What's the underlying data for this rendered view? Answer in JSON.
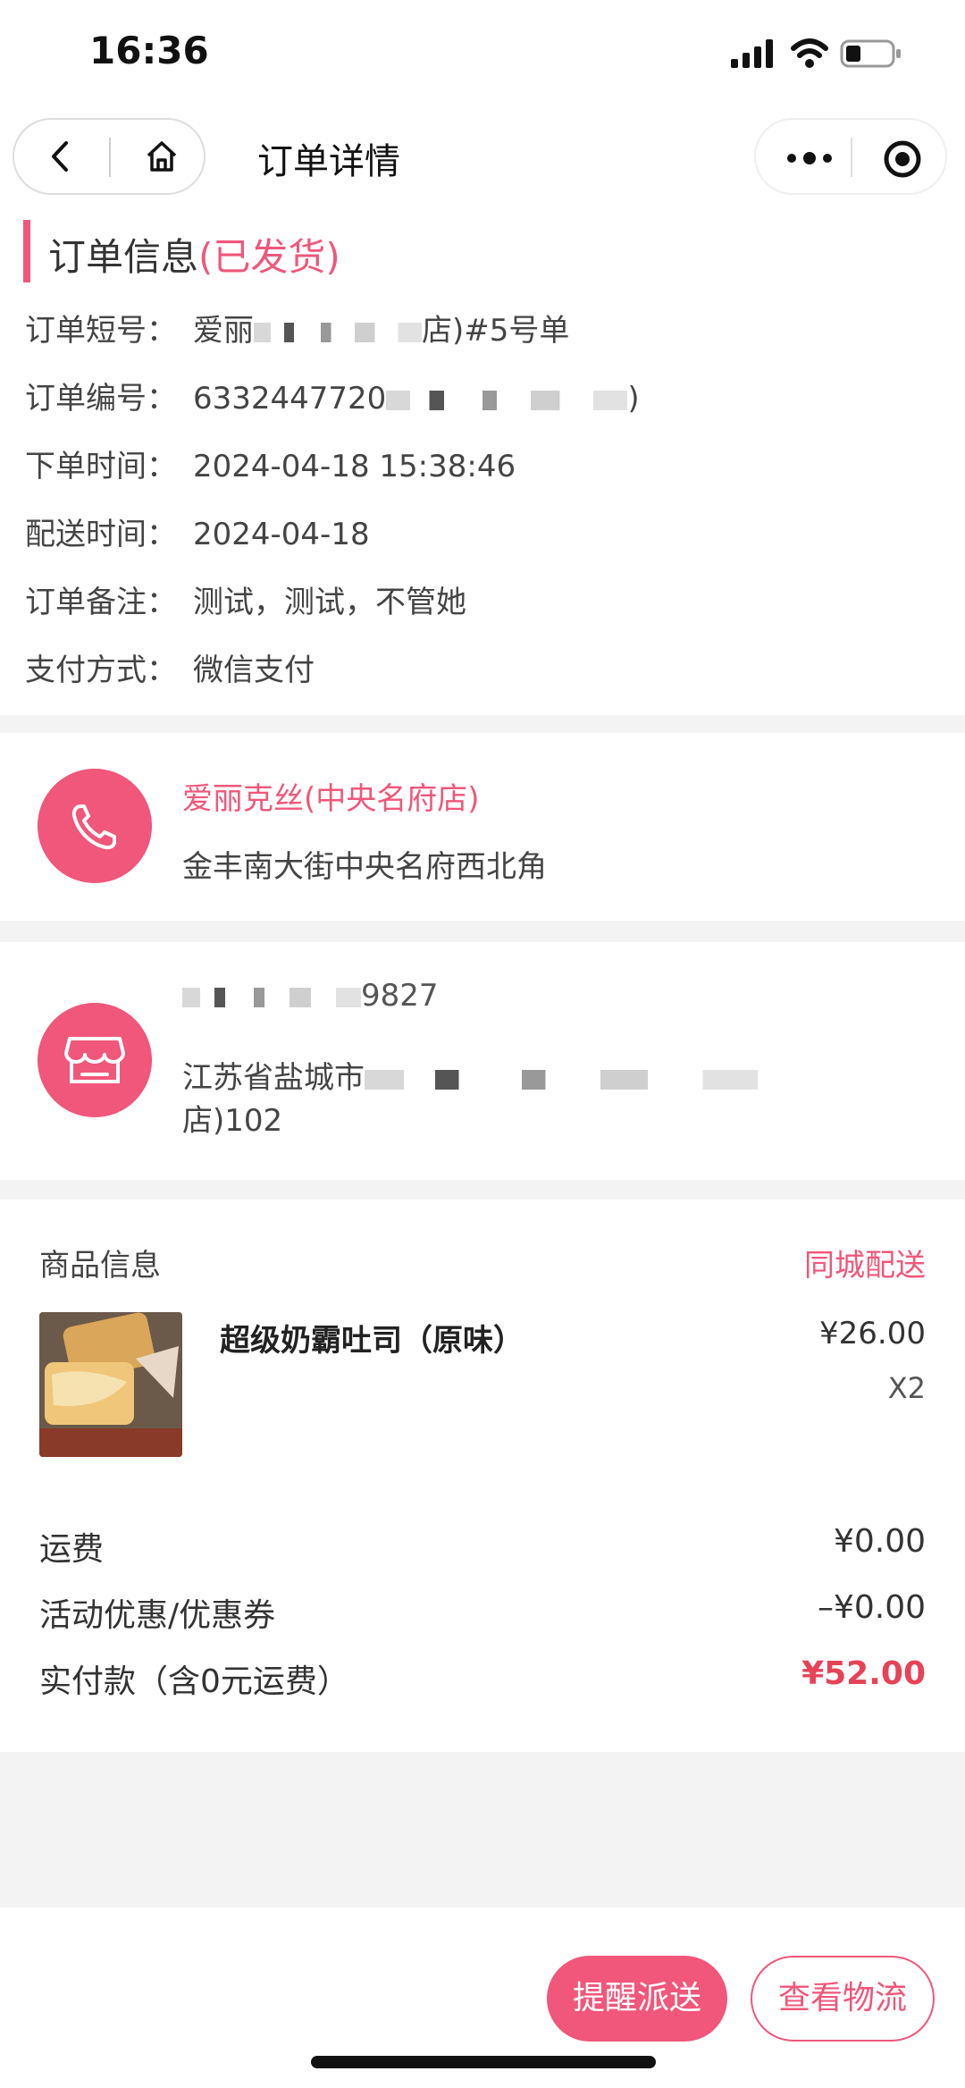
{
  "status_bar": {
    "time": "16:36",
    "signal_icon": "signal-icon",
    "wifi_icon": "wifi-icon",
    "battery_icon": "battery-icon"
  },
  "nav": {
    "title": "订单详情",
    "back_icon": "back-arrow-icon",
    "home_icon": "home-icon",
    "more_icon": "more-dots-icon",
    "close_icon": "target-close-icon"
  },
  "order_info": {
    "title": "订单信息",
    "status": "(已发货)",
    "rows": [
      {
        "label": "订单短号：",
        "value_prefix": "爱丽",
        "value_suffix": "店)#5号单"
      },
      {
        "label": "订单编号：",
        "value_prefix": "6332447720",
        "value_suffix": ")"
      },
      {
        "label": "下单时间：",
        "value": "2024-04-18 15:38:46"
      },
      {
        "label": "配送时间：",
        "value": "2024-04-18"
      },
      {
        "label": "订单备注：",
        "value": "测试，测试，不管她"
      },
      {
        "label": "支付方式：",
        "value": "微信支付"
      }
    ]
  },
  "shop": {
    "name": "爱丽克丝(中央名府店)",
    "address": "金丰南大街中央名府西北角",
    "icon": "phone-icon"
  },
  "delivery_address": {
    "phone_suffix": "9827",
    "address_prefix": "江苏省盐城市",
    "address_line2": "店)102",
    "icon": "store-icon"
  },
  "goods": {
    "title": "商品信息",
    "delivery_type": "同城配送",
    "items": [
      {
        "name": "超级奶霸吐司（原味）",
        "price": "¥26.00",
        "qty": "X2"
      }
    ],
    "fees": [
      {
        "label": "运费",
        "value": "¥0.00"
      },
      {
        "label": "活动优惠/优惠券",
        "value": "–¥0.00"
      },
      {
        "label": "实付款（含0元运费）",
        "value": "¥52.00"
      }
    ]
  },
  "footer": {
    "remind_button": "提醒派送",
    "logistics_button": "查看物流"
  },
  "colors": {
    "accent": "#f0577a",
    "price_red": "#e74256",
    "background": "#f3f3f3"
  }
}
